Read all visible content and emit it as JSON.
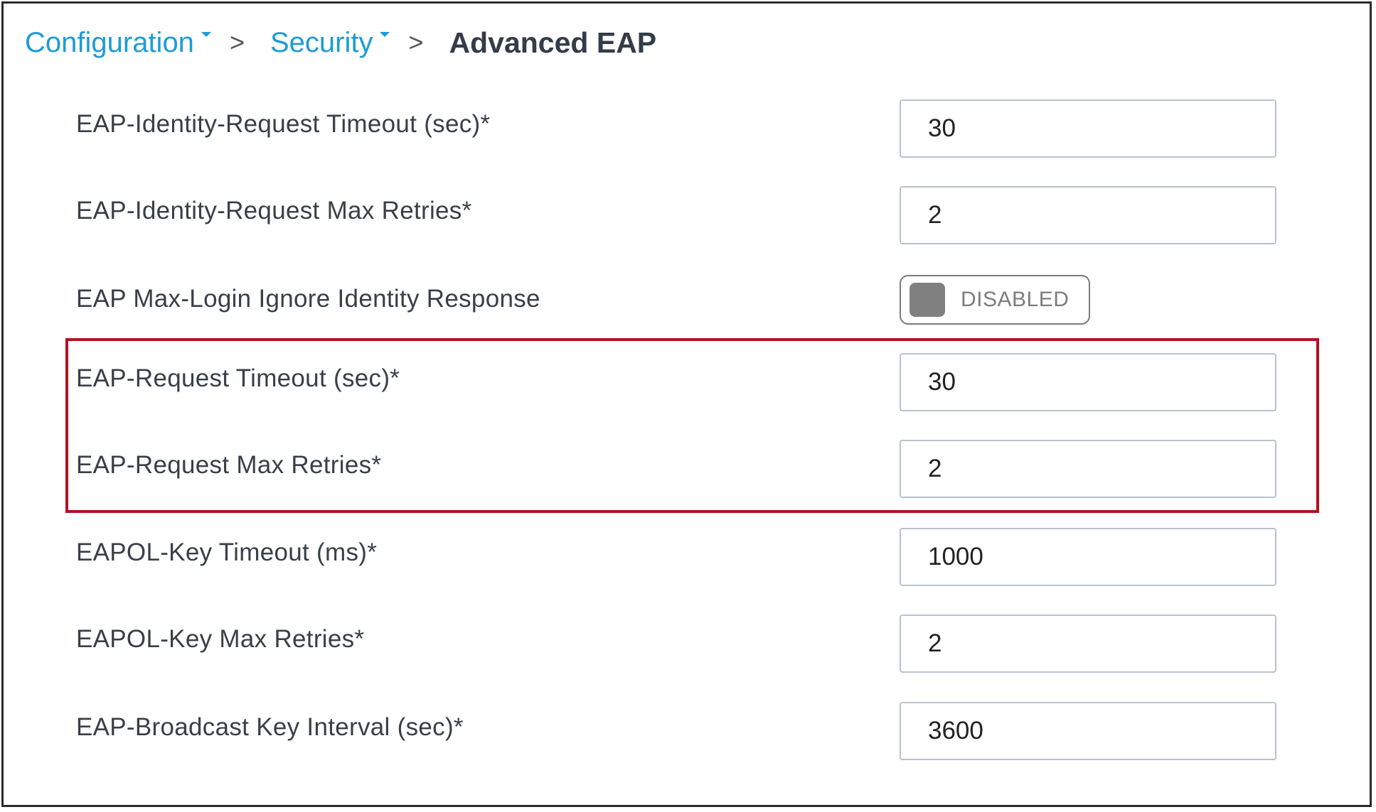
{
  "breadcrumb": {
    "items": [
      {
        "label": "Configuration"
      },
      {
        "label": "Security"
      }
    ],
    "separator": ">",
    "current": "Advanced EAP"
  },
  "fields": {
    "eap_identity_request_timeout": {
      "label": "EAP-Identity-Request Timeout (sec)*",
      "value": "30"
    },
    "eap_identity_request_max_retries": {
      "label": "EAP-Identity-Request Max Retries*",
      "value": "2"
    },
    "eap_max_login_ignore_identity_response": {
      "label": "EAP Max-Login Ignore Identity Response",
      "toggle_text": "DISABLED"
    },
    "eap_request_timeout": {
      "label": "EAP-Request Timeout (sec)*",
      "value": "30"
    },
    "eap_request_max_retries": {
      "label": "EAP-Request Max Retries*",
      "value": "2"
    },
    "eapol_key_timeout": {
      "label": "EAPOL-Key Timeout (ms)*",
      "value": "1000"
    },
    "eapol_key_max_retries": {
      "label": "EAPOL-Key Max Retries*",
      "value": "2"
    },
    "eap_broadcast_key_interval": {
      "label": "EAP-Broadcast Key Interval (sec)*",
      "value": "3600"
    }
  },
  "colors": {
    "link": "#1e9bd7",
    "highlight": "#b5101f",
    "toggle_off": "#808080"
  }
}
